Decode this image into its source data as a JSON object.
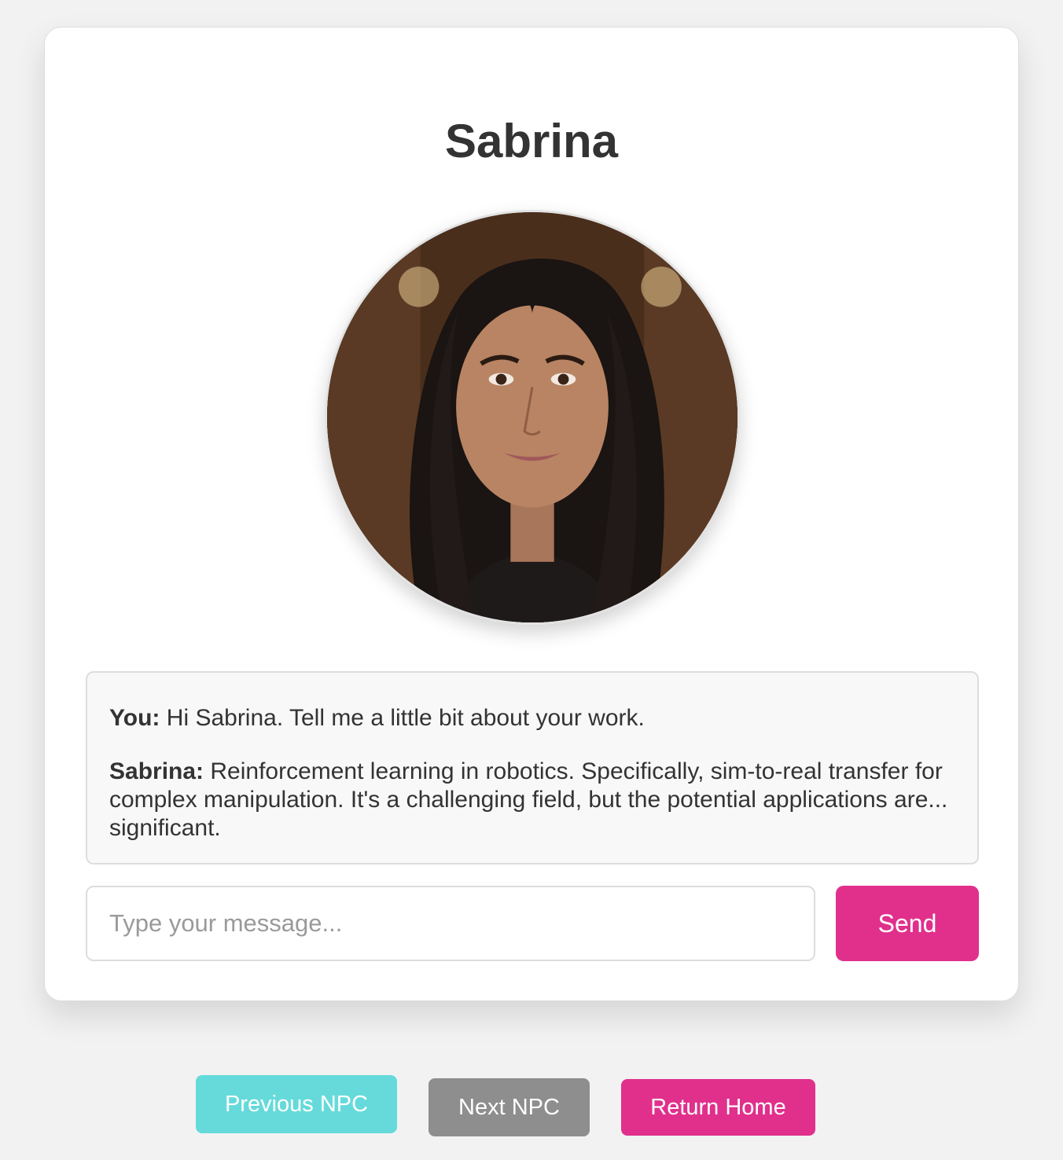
{
  "npc": {
    "name": "Sabrina",
    "avatar_alt": "Sabrina"
  },
  "chat": {
    "messages": [
      {
        "speaker": "You:",
        "text": " Hi Sabrina. Tell me a little bit about your work."
      },
      {
        "speaker": "Sabrina:",
        "text": " Reinforcement learning in robotics. Specifically, sim-to-real transfer for complex manipulation. It's a challenging field, but the potential applications are... significant."
      }
    ]
  },
  "composer": {
    "placeholder": "Type your message...",
    "value": "",
    "send_label": "Send"
  },
  "navigation": {
    "previous_label": "Previous NPC",
    "next_label": "Next NPC",
    "home_label": "Return Home"
  },
  "colors": {
    "accent": "#e0308c",
    "previous": "#66dada",
    "next": "#8e8e8e",
    "background": "#f2f2f2"
  }
}
